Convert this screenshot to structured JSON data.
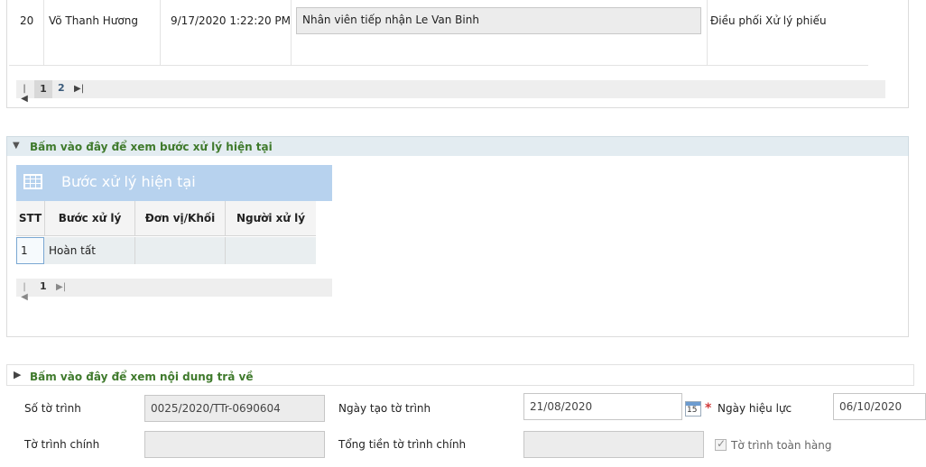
{
  "history_row": {
    "index": "20",
    "person": "Võ Thanh Hương",
    "timestamp": "9/17/2020 1:22:20 PM",
    "note": "Nhân viên tiếp nhận Le Van Binh",
    "action": "Điều phối Xử lý phiếu"
  },
  "history_pager": {
    "first": "⏮",
    "pages": [
      "1",
      "2"
    ],
    "current_page": "1",
    "last": "⏭"
  },
  "current_step_section": {
    "header": "Bấm vào đây để xem bước xử lý hiện tại",
    "grid_title": "Bước xử lý hiện tại",
    "columns": [
      "STT",
      "Bước xử lý",
      "Đơn vị/Khối",
      "Người xử lý"
    ],
    "rows": [
      {
        "stt": "1",
        "step": "Hoàn tất",
        "unit": "",
        "handler": ""
      }
    ],
    "pager": {
      "current_page": "1"
    }
  },
  "return_section": {
    "header": "Bấm vào đây để xem nội dung trả về"
  },
  "form": {
    "so_to_trinh_label": "Số tờ trình",
    "so_to_trinh_value": "0025/2020/TTr-0690604",
    "ngay_tao_label": "Ngày tạo tờ trình",
    "ngay_tao_value": "21/08/2020",
    "calendar_day": "15",
    "required_mark": "*",
    "ngay_hieu_luc_label": "Ngày hiệu lực",
    "ngay_hieu_luc_value": "06/10/2020",
    "to_trinh_chinh_label": "Tờ trình chính",
    "to_trinh_chinh_value": "",
    "tong_tien_label": "Tổng tiền tờ trình chính",
    "tong_tien_value": "",
    "toan_hang_label": "Tờ trình toàn hàng",
    "toan_hang_checked": true,
    "check_glyph": "✓"
  }
}
